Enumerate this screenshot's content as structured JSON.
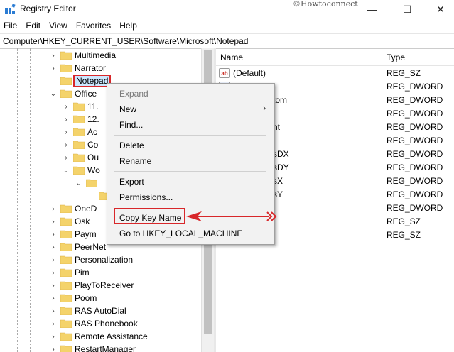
{
  "window": {
    "title": "Registry Editor",
    "watermark": "©Howtoconnect",
    "minimize": "—",
    "maximize": "☐",
    "close": "✕"
  },
  "menubar": [
    "File",
    "Edit",
    "View",
    "Favorites",
    "Help"
  ],
  "address": "Computer\\HKEY_CURRENT_USER\\Software\\Microsoft\\Notepad",
  "tree": [
    {
      "label": "Multimedia",
      "expander": "›"
    },
    {
      "label": "Narrator",
      "expander": "›"
    },
    {
      "label": "Notepad",
      "expander": ""
    },
    {
      "label": "Office",
      "expander": "⌄"
    },
    {
      "label": "11.",
      "expander": "›"
    },
    {
      "label": "12.",
      "expander": "›"
    },
    {
      "label": "Ac",
      "expander": "›"
    },
    {
      "label": "Co",
      "expander": "›"
    },
    {
      "label": "Ou",
      "expander": "›"
    },
    {
      "label": "Wo",
      "expander": "⌄"
    },
    {
      "label": "",
      "expander": "⌄"
    },
    {
      "label": "",
      "expander": ""
    },
    {
      "label": "OneD",
      "expander": "›"
    },
    {
      "label": "Osk",
      "expander": "›"
    },
    {
      "label": "Paym",
      "expander": "›"
    },
    {
      "label": "PeerNet",
      "expander": "›"
    },
    {
      "label": "Personalization",
      "expander": "›"
    },
    {
      "label": "Pim",
      "expander": "›"
    },
    {
      "label": "PlayToReceiver",
      "expander": "›"
    },
    {
      "label": "Poom",
      "expander": "›"
    },
    {
      "label": "RAS AutoDial",
      "expander": "›"
    },
    {
      "label": "RAS Phonebook",
      "expander": "›"
    },
    {
      "label": "Remote Assistance",
      "expander": "›"
    },
    {
      "label": "RestartManager",
      "expander": "›"
    }
  ],
  "list": {
    "col_name": "Name",
    "col_type": "Type",
    "rows": [
      {
        "name": "(Default)",
        "type": "REG_SZ",
        "icon": "sz"
      },
      {
        "name": "",
        "type": "REG_DWORD",
        "icon": "dw"
      },
      {
        "name": "tom",
        "type": "REG_DWORD",
        "icon": ""
      },
      {
        "name": "",
        "type": "REG_DWORD",
        "icon": ""
      },
      {
        "name": "ht",
        "type": "REG_DWORD",
        "icon": ""
      },
      {
        "name": "",
        "type": "REG_DWORD",
        "icon": ""
      },
      {
        "name": "sDX",
        "type": "REG_DWORD",
        "icon": ""
      },
      {
        "name": "sDY",
        "type": "REG_DWORD",
        "icon": ""
      },
      {
        "name": "sX",
        "type": "REG_DWORD",
        "icon": ""
      },
      {
        "name": "sY",
        "type": "REG_DWORD",
        "icon": ""
      },
      {
        "name": "",
        "type": "REG_DWORD",
        "icon": ""
      },
      {
        "name": "",
        "type": "REG_SZ",
        "icon": ""
      },
      {
        "name": "",
        "type": "REG_SZ",
        "icon": ""
      }
    ]
  },
  "context_menu": {
    "expand": "Expand",
    "new": "New",
    "new_arrow": "›",
    "find": "Find...",
    "delete": "Delete",
    "rename": "Rename",
    "export": "Export",
    "permissions": "Permissions...",
    "copy_key_name": "Copy Key Name",
    "goto": "Go to HKEY_LOCAL_MACHINE"
  },
  "colors": {
    "highlight_red": "#d8272a",
    "folder_yellow": "#f4d36b"
  }
}
